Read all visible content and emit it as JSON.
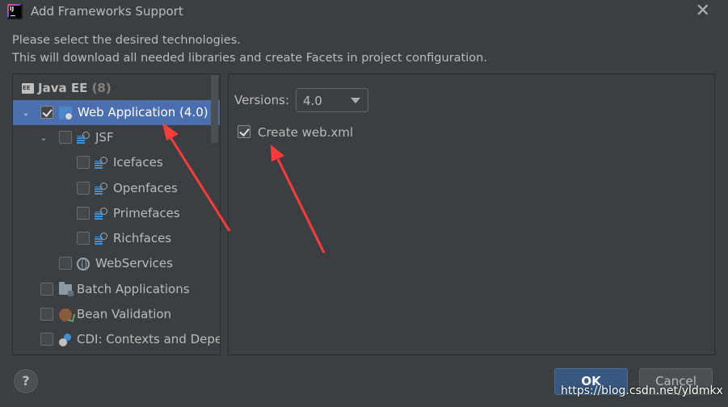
{
  "window": {
    "title": "Add Frameworks Support",
    "close_glyph": "✕"
  },
  "description": {
    "line1": "Please select the desired technologies.",
    "line2": "This will download all needed libraries and create Facets in project configuration."
  },
  "tree": {
    "group": {
      "label": "Java EE",
      "count": "(8)"
    },
    "items": [
      {
        "label": "Web Application (4.0)",
        "checked": true,
        "expanded": true,
        "selected": true
      },
      {
        "label": "JSF",
        "checked": false,
        "expanded": true
      },
      {
        "label": "Icefaces",
        "checked": false
      },
      {
        "label": "Openfaces",
        "checked": false
      },
      {
        "label": "Primefaces",
        "checked": false
      },
      {
        "label": "Richfaces",
        "checked": false
      },
      {
        "label": "WebServices",
        "checked": false
      },
      {
        "label": "Batch Applications",
        "checked": false
      },
      {
        "label": "Bean Validation",
        "checked": false
      },
      {
        "label": "CDI: Contexts and Deper",
        "checked": false
      }
    ]
  },
  "settings": {
    "versions_label": "Versions:",
    "versions_value": "4.0",
    "create_webxml_label": "Create web.xml",
    "create_webxml_checked": true
  },
  "footer": {
    "help_label": "?",
    "ok_label": "OK",
    "cancel_label": "Cancel"
  },
  "watermark": "https://blog.csdn.net/yldmkx",
  "colors": {
    "background": "#3c3f41",
    "selection": "#4b6eaf",
    "ok_button": "#365880",
    "annotation_arrow": "#ff3b3b"
  }
}
